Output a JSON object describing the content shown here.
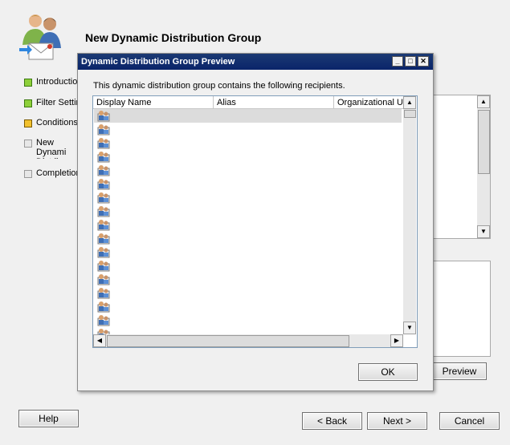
{
  "wizard": {
    "title": "New Dynamic Distribution Group",
    "nav": [
      {
        "label": "Introduction",
        "state": "done"
      },
      {
        "label": "Filter Settings",
        "state": "done"
      },
      {
        "label": "Conditions",
        "state": "current"
      },
      {
        "label": "New Dynamic Distribution",
        "state": "todo"
      },
      {
        "label": "Completion",
        "state": "todo"
      }
    ],
    "preview_label": "Preview",
    "help_label": "Help",
    "back_label": "< Back",
    "next_label": "Next >",
    "cancel_label": "Cancel"
  },
  "dialog": {
    "title": "Dynamic Distribution Group Preview",
    "caption": "This dynamic distribution group contains the following recipients.",
    "columns": [
      "Display Name",
      "Alias",
      "Organizational U"
    ],
    "row_count": 17,
    "ok_label": "OK"
  },
  "icons": {
    "wizard_logo": "users-mail-icon",
    "row_icon": "mailbox-user-icon"
  },
  "colors": {
    "title_bar": "#0a246a",
    "done": "#8ed03a",
    "current": "#f2c12e"
  }
}
